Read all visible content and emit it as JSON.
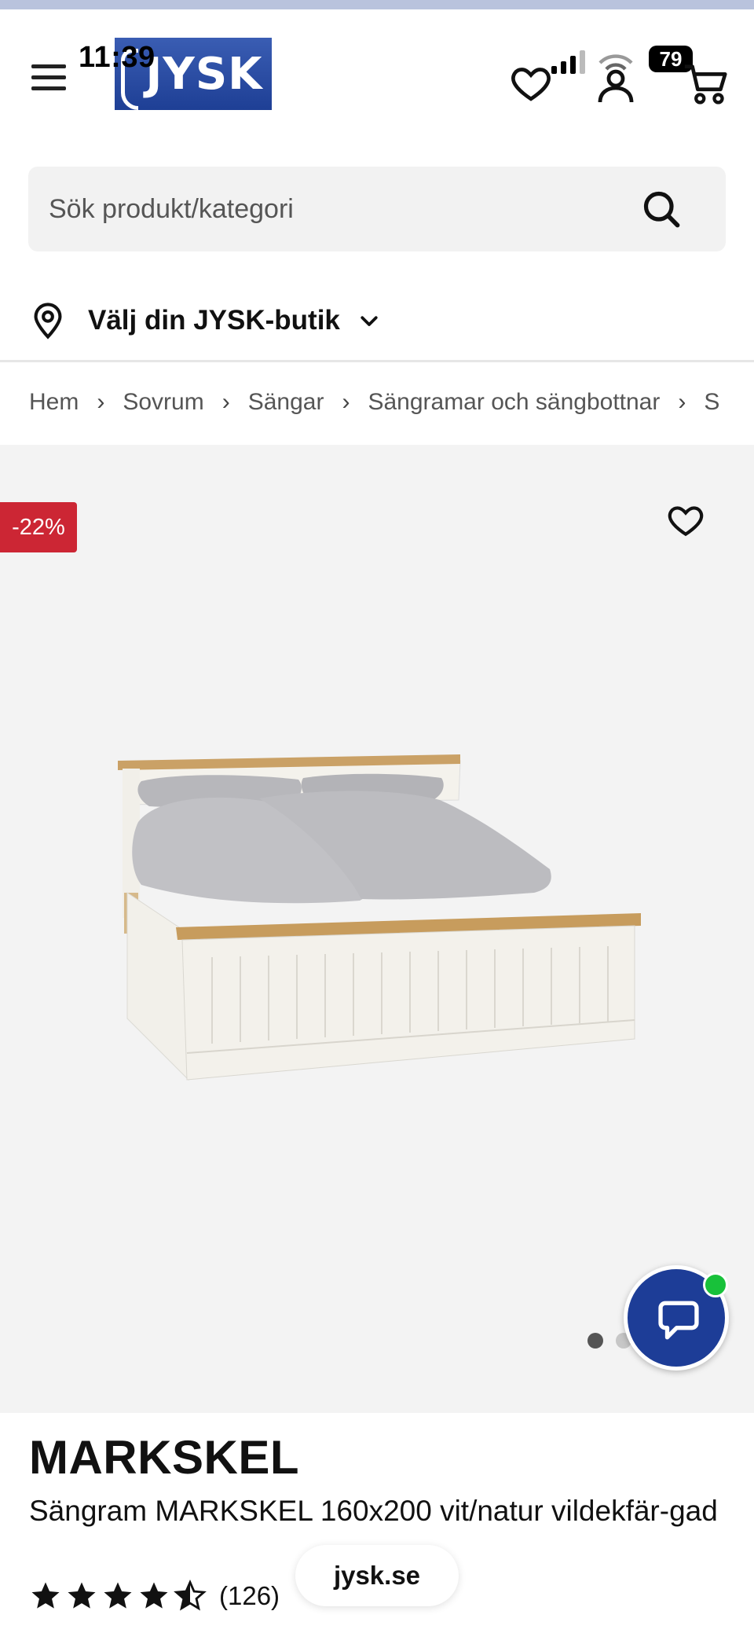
{
  "status_bar": {
    "time": "11:39",
    "battery": "79"
  },
  "header": {
    "logo_text": "JYSK",
    "menu_icon": "hamburger-menu-icon",
    "wishlist_icon": "heart-icon",
    "account_icon": "user-icon",
    "cart_icon": "cart-icon"
  },
  "search": {
    "placeholder": "Sök produkt/kategori",
    "value": "",
    "icon": "search-icon"
  },
  "store": {
    "label": "Välj din JYSK-butik",
    "icon": "location-pin-icon"
  },
  "breadcrumb": [
    "Hem",
    "Sovrum",
    "Sängar",
    "Sängramar och sängbottnar",
    "S"
  ],
  "gallery": {
    "discount_badge": "-22%",
    "favorite_icon": "heart-icon",
    "image_count": 2,
    "active_image": 1
  },
  "chat": {
    "icon": "chat-bubble-icon",
    "online": true
  },
  "product": {
    "name": "MARKSKEL",
    "description": "Sängram MARKSKEL 160x200 vit/natur vildekfär-gad",
    "rating": 4.5,
    "rating_max": 5,
    "review_count": "(126)"
  },
  "browser": {
    "url": "jysk.se"
  },
  "colors": {
    "brand_blue": "#1e3f95",
    "discount_red": "#cc2634",
    "online_green": "#18c13a",
    "gallery_bg": "#f3f3f3"
  }
}
